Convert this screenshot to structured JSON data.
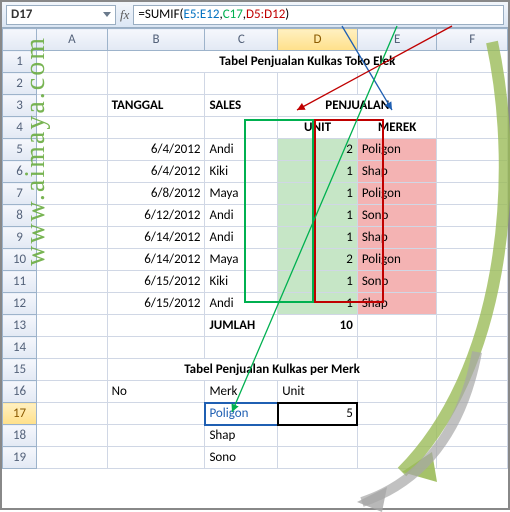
{
  "namebox": {
    "value": "D17"
  },
  "fx": {
    "label": "fx"
  },
  "formula": {
    "prefix": "=SUMIF(",
    "arg1": "E5:E12",
    "sep1": ",",
    "arg2": "C17",
    "sep2": ",",
    "arg3": "D5:D12",
    "suffix": ")"
  },
  "cols": [
    "A",
    "B",
    "C",
    "D",
    "E",
    "F"
  ],
  "rows": [
    "1",
    "2",
    "3",
    "4",
    "5",
    "6",
    "7",
    "8",
    "9",
    "10",
    "11",
    "12",
    "13",
    "14",
    "15",
    "16",
    "17",
    "18",
    "19"
  ],
  "title1": "Tabel Penjualan Kulkas Toko Elek",
  "hdr": {
    "tanggal": "TANGGAL",
    "sales": "SALES",
    "penjualan": "PENJUALAN",
    "unit": "UNIT",
    "merek": "MEREK"
  },
  "data": [
    {
      "tgl": "6/4/2012",
      "sales": "Andi",
      "unit": "2",
      "merek": "Poligon"
    },
    {
      "tgl": "6/4/2012",
      "sales": "Kiki",
      "unit": "1",
      "merek": "Shap"
    },
    {
      "tgl": "6/8/2012",
      "sales": "Maya",
      "unit": "1",
      "merek": "Poligon"
    },
    {
      "tgl": "6/12/2012",
      "sales": "Andi",
      "unit": "1",
      "merek": "Sono"
    },
    {
      "tgl": "6/14/2012",
      "sales": "Andi",
      "unit": "1",
      "merek": "Shap"
    },
    {
      "tgl": "6/14/2012",
      "sales": "Maya",
      "unit": "2",
      "merek": "Poligon"
    },
    {
      "tgl": "6/15/2012",
      "sales": "Kiki",
      "unit": "1",
      "merek": "Sono"
    },
    {
      "tgl": "6/15/2012",
      "sales": "Andi",
      "unit": "1",
      "merek": "Shap"
    }
  ],
  "jumlah": {
    "label": "JUMLAH",
    "value": "10"
  },
  "title2": "Tabel Penjualan Kulkas per Merk",
  "hdr2": {
    "no": "No",
    "merk": "Merk",
    "unit": "Unit"
  },
  "merk_rows": [
    {
      "m": "Poligon",
      "u": "5"
    },
    {
      "m": "Shap",
      "u": ""
    },
    {
      "m": "Sono",
      "u": ""
    }
  ],
  "watermark": "www.aimaya.com"
}
